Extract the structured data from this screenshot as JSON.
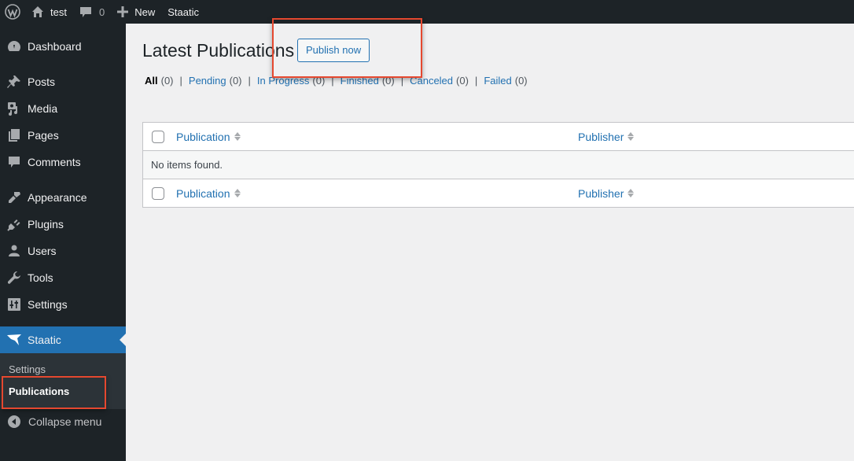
{
  "admin_bar": {
    "site_name": "test",
    "comments_count": "0",
    "new_label": "New",
    "plugin_label": "Staatic",
    "icons": {
      "logo": "wordpress-logo-icon",
      "site": "home-icon",
      "comments": "comment-bubble-icon",
      "new": "plus-icon"
    }
  },
  "sidebar": {
    "items": [
      {
        "label": "Dashboard",
        "icon": "dashboard-gauge-icon"
      },
      {
        "label": "Posts",
        "icon": "pushpin-icon"
      },
      {
        "label": "Media",
        "icon": "media-icon"
      },
      {
        "label": "Pages",
        "icon": "pages-icon"
      },
      {
        "label": "Comments",
        "icon": "comment-bubble-icon"
      },
      {
        "label": "Appearance",
        "icon": "paintbrush-icon"
      },
      {
        "label": "Plugins",
        "icon": "plug-icon"
      },
      {
        "label": "Users",
        "icon": "user-icon"
      },
      {
        "label": "Tools",
        "icon": "wrench-icon"
      },
      {
        "label": "Settings",
        "icon": "settings-sliders-icon"
      },
      {
        "label": "Staatic",
        "icon": "staatic-bird-icon",
        "active": true
      }
    ],
    "submenu": [
      {
        "label": "Settings"
      },
      {
        "label": "Publications",
        "current": true
      }
    ],
    "collapse_label": "Collapse menu"
  },
  "main": {
    "title": "Latest Publications",
    "publish_button": "Publish now",
    "filters": [
      {
        "label": "All",
        "count": "(0)",
        "current": true
      },
      {
        "label": "Pending",
        "count": "(0)"
      },
      {
        "label": "In Progress",
        "count": "(0)"
      },
      {
        "label": "Finished",
        "count": "(0)"
      },
      {
        "label": "Canceled",
        "count": "(0)"
      },
      {
        "label": "Failed",
        "count": "(0)"
      }
    ],
    "filter_separator": "|",
    "table": {
      "columns": [
        "Publication",
        "Publisher"
      ],
      "empty_message": "No items found."
    }
  },
  "colors": {
    "accent": "#2271b1",
    "admin_bg": "#1d2327",
    "annotation": "#e5482f"
  }
}
